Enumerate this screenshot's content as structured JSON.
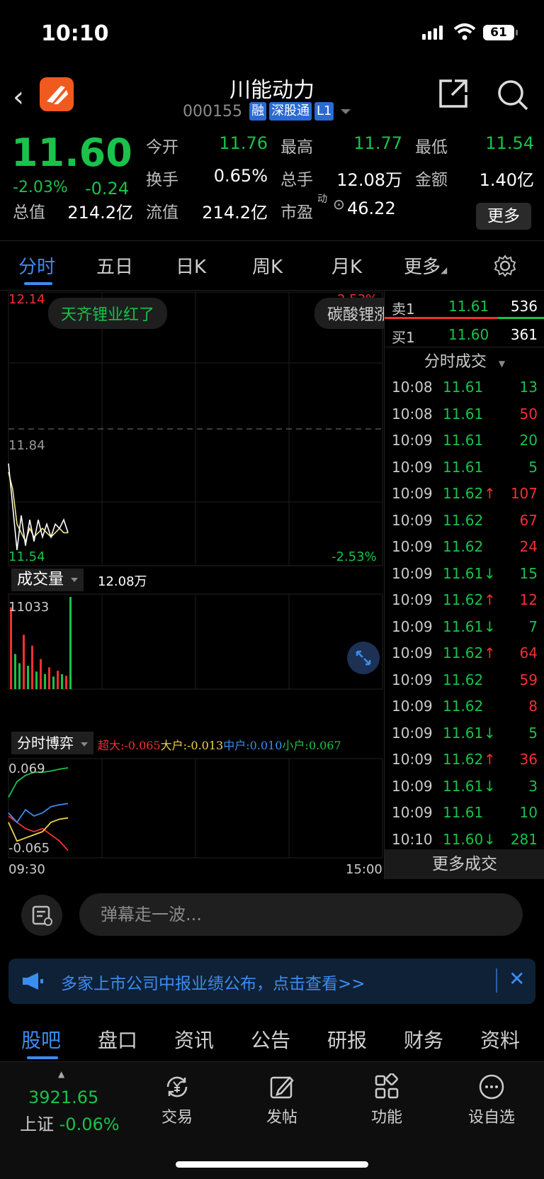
{
  "status": {
    "time": "10:10",
    "battery": "61"
  },
  "header": {
    "title": "川能动力",
    "code": "000155",
    "tags": [
      "融",
      "深股通",
      "L1"
    ]
  },
  "quote": {
    "price": "11.60",
    "change_pct": "-2.03%",
    "change": "-0.24",
    "fields": {
      "open_label": "今开",
      "open": "11.76",
      "high_label": "最高",
      "high": "11.77",
      "low_label": "最低",
      "low": "11.54",
      "turnover_label": "换手",
      "turnover": "0.65%",
      "volume_label": "总手",
      "volume": "12.08万",
      "amount_label": "金额",
      "amount": "1.40亿",
      "mktcap_label": "总值",
      "mktcap": "214.2亿",
      "float_label": "流值",
      "float": "214.2亿",
      "pe_label": "市盈",
      "pe_sup": "动",
      "pe": "46.22"
    },
    "more_label": "更多"
  },
  "tabs": [
    "分时",
    "五日",
    "日K",
    "周K",
    "月K",
    "更多"
  ],
  "chart": {
    "price_top": "12.14",
    "pct_top": "2.53%",
    "price_mid": "11.84",
    "price_bottom": "11.54",
    "pct_bottom": "-2.53%",
    "chip1": "天齐锂业红了",
    "chip2": "碳酸锂涨",
    "volume_label": "成交量",
    "volume_total": "12.08万",
    "volume_max": "11033",
    "flow_label": "分时博弈",
    "flow_super": "超大:-0.065",
    "flow_big": "大户:-0.013",
    "flow_mid": "中户:0.010",
    "flow_small": "小户:0.067",
    "flow_top": "0.069",
    "flow_bottom": "-0.065",
    "time_start": "09:30",
    "time_end": "15:00"
  },
  "chart_data": {
    "type": "line",
    "title": "",
    "ylim": [
      11.54,
      12.14
    ],
    "reference": 11.84,
    "series": [
      {
        "values": [
          11.74,
          11.7,
          11.62,
          11.6,
          11.58,
          11.61,
          11.59,
          11.6,
          11.61,
          11.6,
          11.59,
          11.6,
          11.61,
          11.6,
          11.6
        ]
      },
      {
        "values": [
          11.76,
          11.66,
          11.56,
          11.64,
          11.57,
          11.63,
          11.58,
          11.63,
          11.59,
          11.62,
          11.59,
          11.62,
          11.61,
          11.63,
          11.6
        ]
      }
    ],
    "volume": [
      9800,
      4200,
      3100,
      6500,
      2800,
      5200,
      2100,
      3600,
      1800,
      2600,
      1500,
      2200,
      1800,
      1600,
      11033
    ],
    "flow": {
      "super": [
        -0.01,
        -0.02,
        -0.03,
        -0.035,
        -0.03,
        -0.04,
        -0.05,
        -0.065
      ],
      "big": [
        -0.02,
        -0.05,
        -0.045,
        -0.04,
        -0.035,
        -0.02,
        -0.015,
        -0.013
      ],
      "mid": [
        -0.005,
        -0.02,
        0.0,
        -0.01,
        -0.005,
        0.005,
        0.008,
        0.01
      ],
      "small": [
        0.02,
        0.045,
        0.055,
        0.06,
        0.06,
        0.062,
        0.065,
        0.067
      ]
    }
  },
  "book": {
    "sell_label": "卖1",
    "sell_price": "11.61",
    "sell_qty": "536",
    "buy_label": "买1",
    "buy_price": "11.60",
    "buy_qty": "361",
    "trades_label": "分时成交",
    "trades": [
      {
        "t": "10:08",
        "p": "11.61",
        "a": "",
        "q": "13",
        "c": "green"
      },
      {
        "t": "10:08",
        "p": "11.61",
        "a": "",
        "q": "50",
        "c": "red"
      },
      {
        "t": "10:09",
        "p": "11.61",
        "a": "",
        "q": "20",
        "c": "green"
      },
      {
        "t": "10:09",
        "p": "11.61",
        "a": "",
        "q": "5",
        "c": "green"
      },
      {
        "t": "10:09",
        "p": "11.62",
        "a": "↑",
        "q": "107",
        "c": "red"
      },
      {
        "t": "10:09",
        "p": "11.62",
        "a": "",
        "q": "67",
        "c": "red"
      },
      {
        "t": "10:09",
        "p": "11.62",
        "a": "",
        "q": "24",
        "c": "red"
      },
      {
        "t": "10:09",
        "p": "11.61",
        "a": "↓",
        "q": "15",
        "c": "green"
      },
      {
        "t": "10:09",
        "p": "11.62",
        "a": "↑",
        "q": "12",
        "c": "red"
      },
      {
        "t": "10:09",
        "p": "11.61",
        "a": "↓",
        "q": "7",
        "c": "green"
      },
      {
        "t": "10:09",
        "p": "11.62",
        "a": "↑",
        "q": "64",
        "c": "red"
      },
      {
        "t": "10:09",
        "p": "11.62",
        "a": "",
        "q": "59",
        "c": "red"
      },
      {
        "t": "10:09",
        "p": "11.62",
        "a": "",
        "q": "8",
        "c": "red"
      },
      {
        "t": "10:09",
        "p": "11.61",
        "a": "↓",
        "q": "5",
        "c": "green"
      },
      {
        "t": "10:09",
        "p": "11.62",
        "a": "↑",
        "q": "36",
        "c": "red"
      },
      {
        "t": "10:09",
        "p": "11.61",
        "a": "↓",
        "q": "3",
        "c": "green"
      },
      {
        "t": "10:09",
        "p": "11.61",
        "a": "",
        "q": "10",
        "c": "green"
      },
      {
        "t": "10:10",
        "p": "11.60",
        "a": "↓",
        "q": "281",
        "c": "green"
      }
    ],
    "more_trades": "更多成交"
  },
  "danmu": {
    "placeholder": "弹幕走一波...",
    "button": "弹"
  },
  "notice": {
    "text": "多家上市公司中报业绩公布，点击查看>>"
  },
  "bottom_tabs": [
    "股吧",
    "盘口",
    "资讯",
    "公告",
    "研报",
    "财务",
    "资料"
  ],
  "footer": {
    "index_value": "3921.65",
    "index_name": "上证",
    "index_change": "-0.06%",
    "nav": [
      "交易",
      "发帖",
      "功能",
      "设自选"
    ]
  },
  "colors": {
    "up": "#f23030",
    "down": "#19c24a",
    "accent": "#3d8cf0"
  }
}
